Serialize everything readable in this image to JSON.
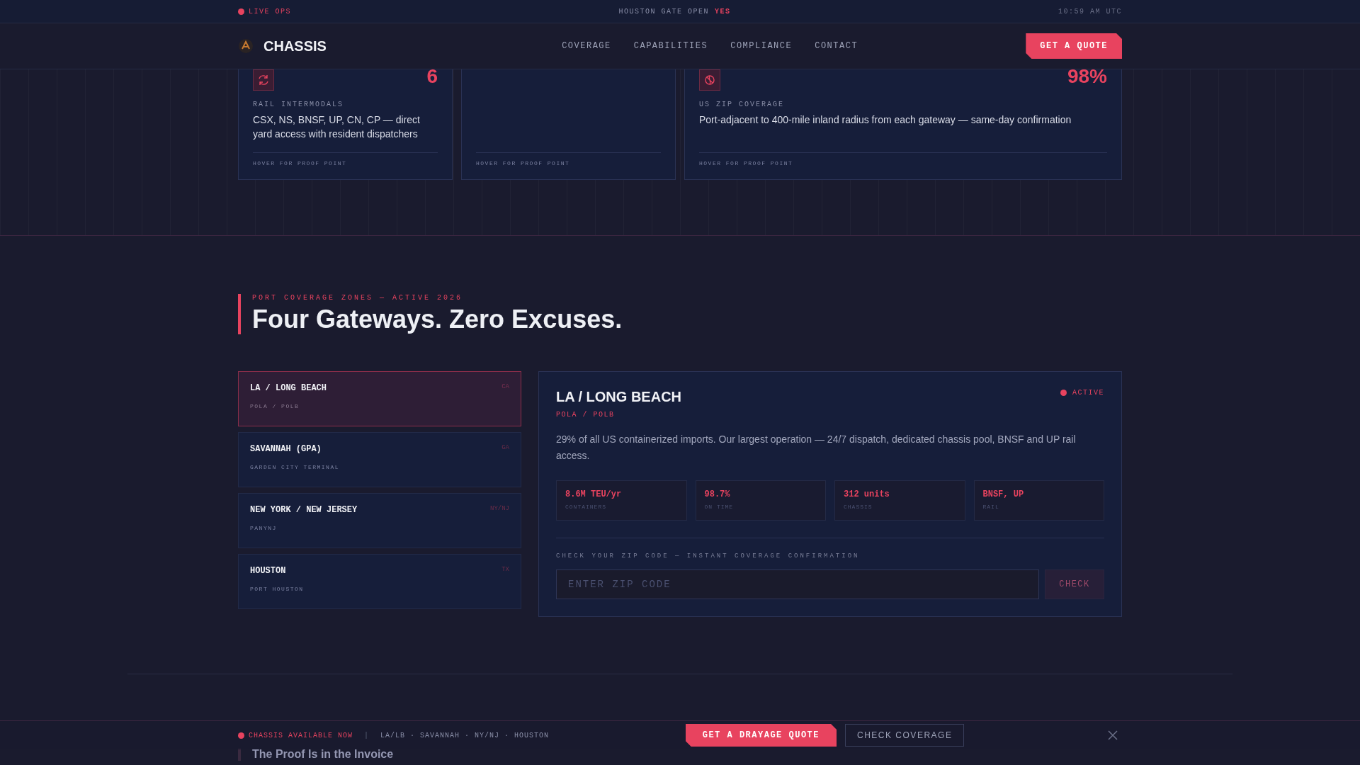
{
  "top_bar": {
    "live_label": "LIVE OPS",
    "gate_label": "HOUSTON GATE OPEN",
    "gate_status": "YES",
    "time": "10:59 AM UTC"
  },
  "nav": {
    "brand": "CHASSIS",
    "links": [
      "COVERAGE",
      "CAPABILITIES",
      "COMPLIANCE",
      "CONTACT"
    ],
    "cta": "GET A QUOTE"
  },
  "stat_cards": [
    {
      "kind": "rail",
      "value": "6",
      "label": "RAIL INTERMODALS",
      "text": "CSX, NS, BNSF, UP, CN, CP — direct yard access with resident dispatchers",
      "footer": "HOVER FOR PROOF POINT"
    },
    {
      "kind": "blank",
      "footer": "HOVER FOR PROOF POINT"
    },
    {
      "kind": "zip",
      "value": "98%",
      "label": "US ZIP COVERAGE",
      "text": "Port-adjacent to 400-mile inland radius from each gateway — same-day confirmation",
      "footer": "HOVER FOR PROOF POINT"
    }
  ],
  "coverage": {
    "eyebrow": "PORT COVERAGE ZONES — ACTIVE 2026",
    "title": "Four Gateways. Zero Excuses.",
    "ports": [
      {
        "name": "LA / LONG BEACH",
        "state": "CA",
        "terminal": "POLA / POLB",
        "selected": true
      },
      {
        "name": "SAVANNAH (GPA)",
        "state": "GA",
        "terminal": "GARDEN CITY TERMINAL",
        "selected": false
      },
      {
        "name": "NEW YORK / NEW JERSEY",
        "state": "NY/NJ",
        "terminal": "PANYNJ",
        "selected": false
      },
      {
        "name": "HOUSTON",
        "state": "TX",
        "terminal": "PORT HOUSTON",
        "selected": false
      }
    ],
    "detail": {
      "title": "LA / LONG BEACH",
      "subtitle": "POLA / POLB",
      "status": "ACTIVE",
      "description": "29% of all US containerized imports. Our largest operation — 24/7 dispatch, dedicated chassis pool, BNSF and UP rail access.",
      "metrics": [
        {
          "value": "8.6M TEU/yr",
          "label": "CONTAINERS"
        },
        {
          "value": "98.7%",
          "label": "ON TIME"
        },
        {
          "value": "312 units",
          "label": "CHASSIS"
        },
        {
          "value": "BNSF, UP",
          "label": "RAIL"
        }
      ],
      "zip_label": "CHECK YOUR ZIP CODE — INSTANT COVERAGE CONFIRMATION",
      "zip_placeholder": "ENTER ZIP CODE",
      "check_button": "CHECK"
    }
  },
  "next_section_title": "The Proof Is in the Invoice",
  "sticky_bar": {
    "availability": "CHASSIS AVAILABLE NOW",
    "separator": "|",
    "ports": "LA/LB · SAVANNAH · NY/NJ · HOUSTON",
    "primary": "GET A DRAYAGE QUOTE",
    "secondary": "CHECK COVERAGE"
  }
}
